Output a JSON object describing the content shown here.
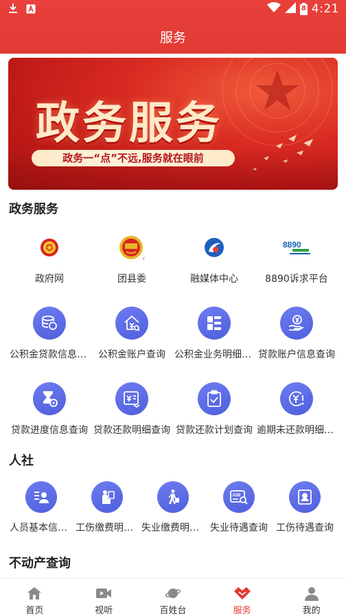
{
  "status_bar": {
    "time": "4:21",
    "battery": "8"
  },
  "header": {
    "title": "服务"
  },
  "banner": {
    "heading": "政务服务",
    "slogan": "政务一“点”不远,服务就在眼前"
  },
  "sections": {
    "gov": {
      "title": "政务服务",
      "row1": [
        {
          "label": "政府网",
          "icon": "national-emblem-icon"
        },
        {
          "label": "团县委",
          "icon": "youth-league-icon"
        },
        {
          "label": "融媒体中心",
          "icon": "media-center-icon"
        },
        {
          "label": "8890诉求平台",
          "icon": "hotline-8890-icon"
        }
      ],
      "row2": [
        {
          "label": "公积金贷款信息查询",
          "icon": "coins-icon"
        },
        {
          "label": "公积金账户查询",
          "icon": "house-yen-icon"
        },
        {
          "label": "公积金业务明细查询",
          "icon": "grid-list-icon"
        },
        {
          "label": "贷款账户信息查询",
          "icon": "hand-coin-icon"
        }
      ],
      "row3": [
        {
          "label": "贷款进度信息查询",
          "icon": "hourglass-gear-icon"
        },
        {
          "label": "贷款还款明细查询",
          "icon": "bill-refresh-icon"
        },
        {
          "label": "贷款还款计划查询",
          "icon": "clipboard-check-icon"
        },
        {
          "label": "逾期未还款明细查询",
          "icon": "yen-alert-icon"
        }
      ]
    },
    "social": {
      "title": "人社",
      "items": [
        {
          "label": "人员基本信息查询",
          "icon": "person-card-icon"
        },
        {
          "label": "工伤缴费明细查询",
          "icon": "injured-worker-icon"
        },
        {
          "label": "失业缴费明细查询",
          "icon": "walking-person-icon"
        },
        {
          "label": "失业待遇查询",
          "icon": "job-search-icon"
        },
        {
          "label": "工伤待遇查询",
          "icon": "id-badge-icon"
        }
      ]
    },
    "realestate": {
      "title": "不动产查询"
    }
  },
  "tabbar": {
    "items": [
      {
        "label": "首页",
        "icon": "home-icon"
      },
      {
        "label": "视听",
        "icon": "video-icon"
      },
      {
        "label": "百姓台",
        "icon": "planet-icon"
      },
      {
        "label": "服务",
        "icon": "handshake-icon"
      },
      {
        "label": "我的",
        "icon": "user-icon"
      }
    ],
    "active": "服务"
  },
  "colors": {
    "brand": "#e23a35",
    "icon_bg": "#5b69e6"
  }
}
